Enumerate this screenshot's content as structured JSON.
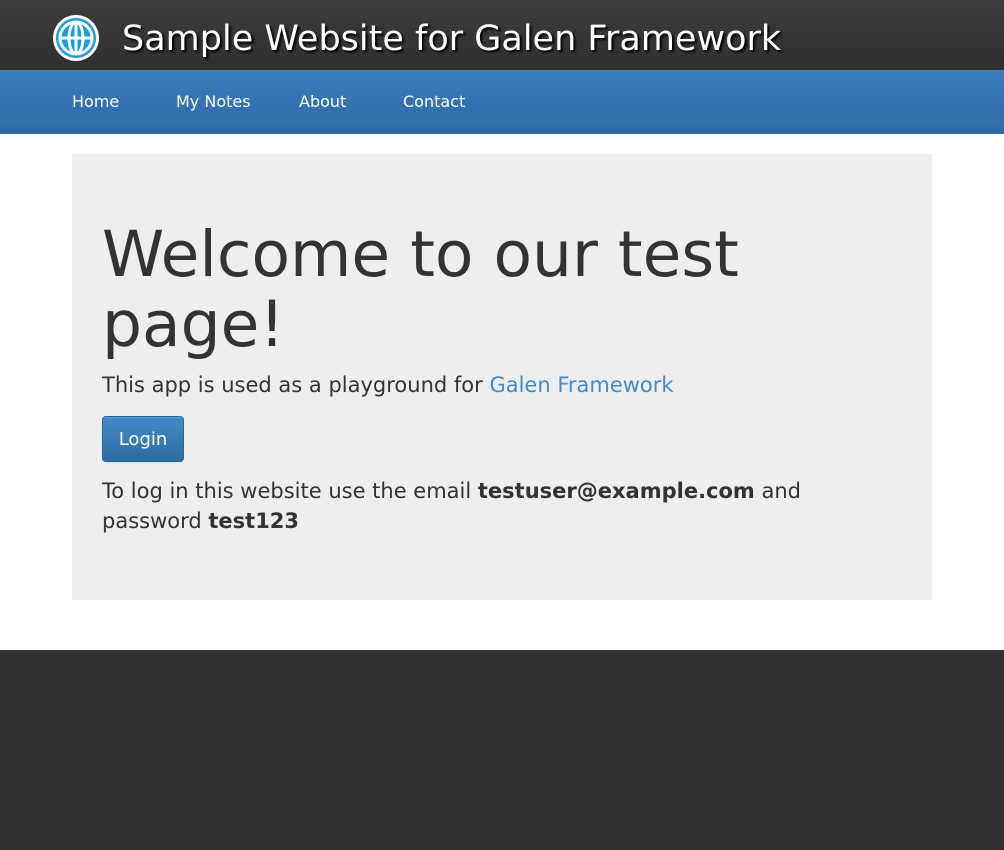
{
  "header": {
    "title": "Sample Website for Galen Framework",
    "logo_icon": "globe-icon"
  },
  "nav": {
    "items": [
      {
        "label": "Home"
      },
      {
        "label": "My Notes"
      },
      {
        "label": "About"
      },
      {
        "label": "Contact"
      }
    ]
  },
  "main": {
    "heading": "Welcome to our test page!",
    "lead_prefix": "This app is used as a playground for ",
    "lead_link": "Galen Framework",
    "login_label": "Login",
    "creds_prefix": "To log in this website use the email ",
    "email": "testuser@example.com",
    "creds_middle": " and password ",
    "password": "test123"
  },
  "colors": {
    "header_bg": "#333333",
    "nav_bg": "#3574b3",
    "jumbotron_bg": "#eeeeee",
    "link": "#428bca",
    "button": "#337ab7",
    "footer_bg": "#333333"
  }
}
